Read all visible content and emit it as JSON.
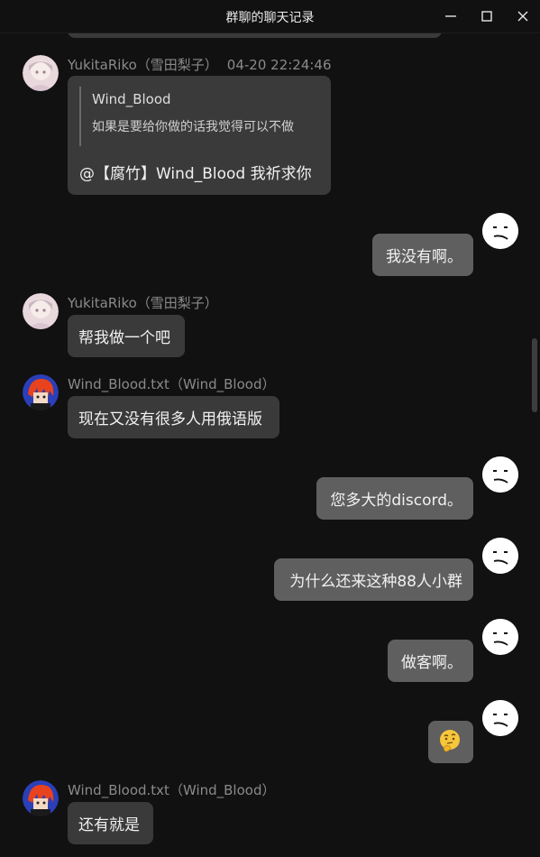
{
  "window": {
    "title": "群聊的聊天记录",
    "minimize_icon": "minimize-icon",
    "maximize_icon": "maximize-icon",
    "close_icon": "close-icon"
  },
  "messages": [
    {
      "sender": "YukitaRiko（雪田梨子）",
      "time": "04-20 22:24:46",
      "avatar": "anime-girl-avatar",
      "quote": {
        "author": "Wind_Blood",
        "text": "如果是要给你做的话我觉得可以不做"
      },
      "text": "@【腐竹】Wind_Blood 我祈求你"
    },
    {
      "self": true,
      "avatar": "neutral-face-avatar",
      "text": "我没有啊。"
    },
    {
      "sender": "YukitaRiko（雪田梨子）",
      "avatar": "anime-girl-avatar",
      "text": "帮我做一个吧"
    },
    {
      "sender": "Wind_Blood.txt（Wind_Blood）",
      "avatar": "red-hair-character-avatar",
      "text": "现在又没有很多人用俄语版"
    },
    {
      "self": true,
      "avatar": "neutral-face-avatar",
      "text": "您多大的discord。"
    },
    {
      "self": true,
      "avatar": "neutral-face-avatar",
      "text": "为什么还来这种88人小群"
    },
    {
      "self": true,
      "avatar": "neutral-face-avatar",
      "text": "做客啊。"
    },
    {
      "self": true,
      "avatar": "neutral-face-avatar",
      "emoji": "thinking-face-emoji"
    },
    {
      "sender": "Wind_Blood.txt（Wind_Blood）",
      "avatar": "red-hair-character-avatar",
      "text": "还有就是"
    }
  ],
  "colors": {
    "background": "#111111",
    "incoming_bubble": "#3a3a3a",
    "outgoing_bubble": "#5f5f5f",
    "meta_text": "#8a8a8a"
  }
}
